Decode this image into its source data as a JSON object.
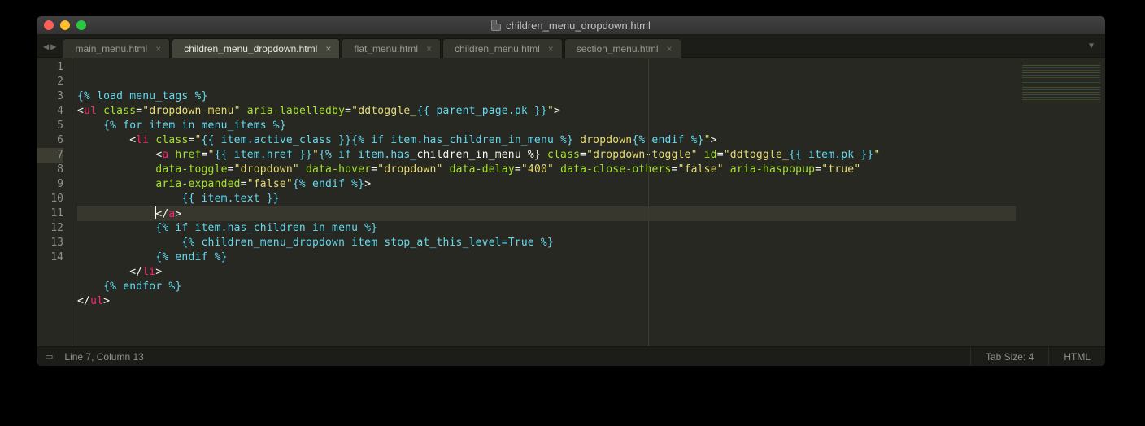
{
  "title": "children_menu_dropdown.html",
  "tabs": [
    {
      "label": "main_menu.html",
      "active": false
    },
    {
      "label": "children_menu_dropdown.html",
      "active": true
    },
    {
      "label": "flat_menu.html",
      "active": false
    },
    {
      "label": "children_menu.html",
      "active": false
    },
    {
      "label": "section_menu.html",
      "active": false
    }
  ],
  "gutter": {
    "lines": [
      "1",
      "2",
      "3",
      "4",
      "5",
      "6",
      "7",
      "8",
      "9",
      "10",
      "11",
      "12",
      "13",
      "14"
    ],
    "active_line": 7
  },
  "code": {
    "active_line": 7,
    "lines": [
      [
        {
          "t": "{% load menu_tags %}",
          "c": "c"
        }
      ],
      [
        {
          "t": "<",
          "c": "w"
        },
        {
          "t": "ul",
          "c": "p"
        },
        {
          "t": " ",
          "c": "w"
        },
        {
          "t": "class",
          "c": "g"
        },
        {
          "t": "=",
          "c": "w"
        },
        {
          "t": "\"dropdown-menu\"",
          "c": "y"
        },
        {
          "t": " ",
          "c": "w"
        },
        {
          "t": "aria-labelledby",
          "c": "g"
        },
        {
          "t": "=",
          "c": "w"
        },
        {
          "t": "\"ddtoggle_",
          "c": "y"
        },
        {
          "t": "{{ parent_page.pk }}",
          "c": "c"
        },
        {
          "t": "\"",
          "c": "y"
        },
        {
          "t": ">",
          "c": "w"
        }
      ],
      [
        {
          "t": "    ",
          "c": "w"
        },
        {
          "t": "{% for item in menu_items %}",
          "c": "c"
        }
      ],
      [
        {
          "t": "        <",
          "c": "w"
        },
        {
          "t": "li",
          "c": "p"
        },
        {
          "t": " ",
          "c": "w"
        },
        {
          "t": "class",
          "c": "g"
        },
        {
          "t": "=",
          "c": "w"
        },
        {
          "t": "\"",
          "c": "y"
        },
        {
          "t": "{{ item.active_class }}",
          "c": "c"
        },
        {
          "t": "{% if item.has_children_in_menu %}",
          "c": "c"
        },
        {
          "t": " dropdown",
          "c": "y"
        },
        {
          "t": "{% endif %}",
          "c": "c"
        },
        {
          "t": "\"",
          "c": "y"
        },
        {
          "t": ">",
          "c": "w"
        }
      ],
      [
        {
          "t": "            <",
          "c": "w"
        },
        {
          "t": "a",
          "c": "p"
        },
        {
          "t": " ",
          "c": "w"
        },
        {
          "t": "href",
          "c": "g"
        },
        {
          "t": "=",
          "c": "w"
        },
        {
          "t": "\"",
          "c": "y"
        },
        {
          "t": "{{ item.href }}",
          "c": "c"
        },
        {
          "t": "\"",
          "c": "y"
        },
        {
          "t": "{% if item.has_",
          "c": "c"
        },
        {
          "t": "children_in_menu %}",
          "c": "w"
        },
        {
          "t": " ",
          "c": "w"
        },
        {
          "t": "class",
          "c": "g"
        },
        {
          "t": "=",
          "c": "w"
        },
        {
          "t": "\"dropdown-toggle\"",
          "c": "y"
        },
        {
          "t": " ",
          "c": "w"
        },
        {
          "t": "id",
          "c": "g"
        },
        {
          "t": "=",
          "c": "w"
        },
        {
          "t": "\"ddtoggle_",
          "c": "y"
        },
        {
          "t": "{{ item.pk }}",
          "c": "c"
        },
        {
          "t": "\"",
          "c": "y"
        }
      ],
      [
        {
          "t": "            ",
          "c": "w"
        },
        {
          "t": "data-toggle",
          "c": "g"
        },
        {
          "t": "=",
          "c": "w"
        },
        {
          "t": "\"dropdown\"",
          "c": "y"
        },
        {
          "t": " ",
          "c": "w"
        },
        {
          "t": "data-hover",
          "c": "g"
        },
        {
          "t": "=",
          "c": "w"
        },
        {
          "t": "\"dropdown\"",
          "c": "y"
        },
        {
          "t": " ",
          "c": "w"
        },
        {
          "t": "data-delay",
          "c": "g"
        },
        {
          "t": "=",
          "c": "w"
        },
        {
          "t": "\"400\"",
          "c": "y"
        },
        {
          "t": " ",
          "c": "w"
        },
        {
          "t": "data-close-others",
          "c": "g"
        },
        {
          "t": "=",
          "c": "w"
        },
        {
          "t": "\"false\"",
          "c": "y"
        },
        {
          "t": " ",
          "c": "w"
        },
        {
          "t": "aria-haspopup",
          "c": "g"
        },
        {
          "t": "=",
          "c": "w"
        },
        {
          "t": "\"true\"",
          "c": "y"
        }
      ],
      [
        {
          "t": "            ",
          "c": "w"
        },
        {
          "t": "aria-expanded",
          "c": "g"
        },
        {
          "t": "=",
          "c": "w"
        },
        {
          "t": "\"false\"",
          "c": "y"
        },
        {
          "t": "{% endif %}",
          "c": "c"
        },
        {
          "t": ">",
          "c": "w"
        }
      ],
      [
        {
          "t": "                ",
          "c": "w"
        },
        {
          "t": "{{ item.text }}",
          "c": "c"
        }
      ],
      [
        {
          "t": "            ",
          "c": "w"
        },
        {
          "caret": true
        },
        {
          "t": "</",
          "c": "w"
        },
        {
          "t": "a",
          "c": "p"
        },
        {
          "t": ">",
          "c": "w"
        }
      ],
      [
        {
          "t": "            ",
          "c": "w"
        },
        {
          "t": "{% if item.has_children_in_menu %}",
          "c": "c"
        }
      ],
      [
        {
          "t": "                ",
          "c": "w"
        },
        {
          "t": "{% children_menu_dropdown item stop_at_this_level=True %}",
          "c": "c"
        }
      ],
      [
        {
          "t": "            ",
          "c": "w"
        },
        {
          "t": "{% endif %}",
          "c": "c"
        }
      ],
      [
        {
          "t": "        </",
          "c": "w"
        },
        {
          "t": "li",
          "c": "p"
        },
        {
          "t": ">",
          "c": "w"
        }
      ],
      [
        {
          "t": "    ",
          "c": "w"
        },
        {
          "t": "{% endfor %}",
          "c": "c"
        }
      ],
      [
        {
          "t": "</",
          "c": "w"
        },
        {
          "t": "ul",
          "c": "p"
        },
        {
          "t": ">",
          "c": "w"
        }
      ],
      []
    ]
  },
  "status": {
    "position": "Line 7, Column 13",
    "tab_size": "Tab Size: 4",
    "syntax": "HTML"
  }
}
